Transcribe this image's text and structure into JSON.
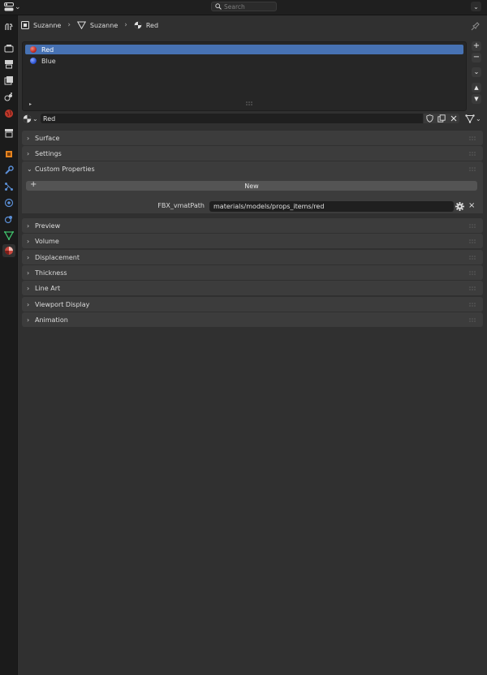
{
  "header": {
    "search_placeholder": "Search"
  },
  "breadcrumb": {
    "object": "Suzanne",
    "mesh": "Suzanne",
    "material": "Red"
  },
  "material_slots": [
    {
      "name": "Red",
      "color": "#d8362e",
      "selected": true
    },
    {
      "name": "Blue",
      "color": "#2f57d6",
      "selected": false
    }
  ],
  "material": {
    "name": "Red"
  },
  "panels": {
    "surface": "Surface",
    "settings": "Settings",
    "custom_properties": "Custom Properties",
    "preview": "Preview",
    "volume": "Volume",
    "displacement": "Displacement",
    "thickness": "Thickness",
    "line_art": "Line Art",
    "viewport_display": "Viewport Display",
    "animation": "Animation"
  },
  "custom_properties": {
    "new_label": "New",
    "property_name": "FBX_vmatPath",
    "property_value": "materials/models/props_items/red"
  },
  "colors": {
    "selection": "#4772b3",
    "panel": "#3c3c3c",
    "background": "#303030"
  }
}
